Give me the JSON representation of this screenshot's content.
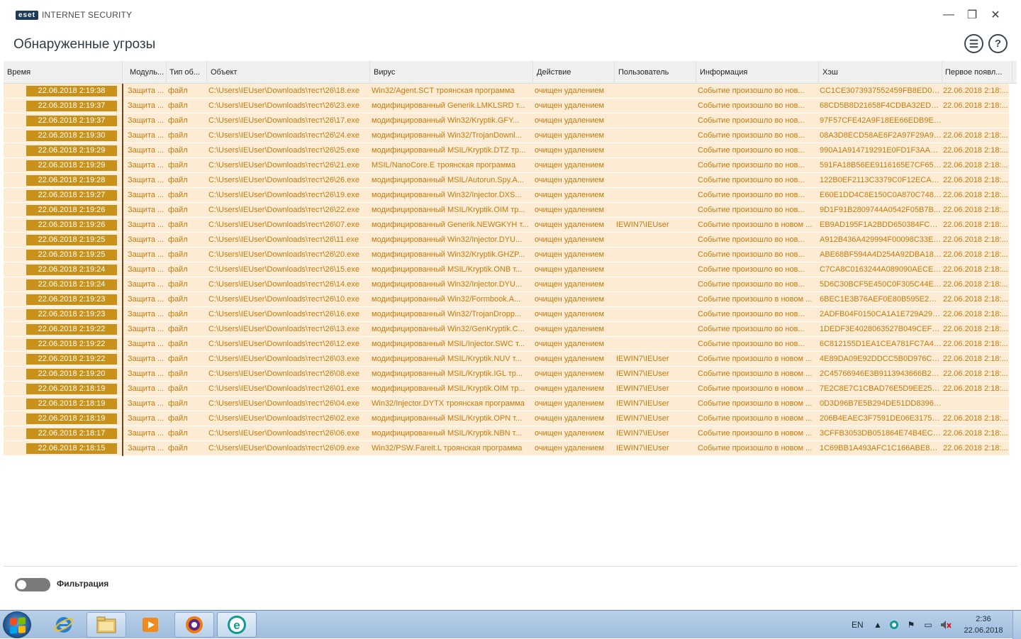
{
  "app": {
    "badge": "eset",
    "name": "INTERNET SECURITY"
  },
  "window_controls": {
    "minimize": "—",
    "maximize": "❐",
    "close": "✕"
  },
  "page": {
    "title": "Обнаруженные угрозы"
  },
  "header_icons": {
    "list": "☰",
    "help": "?"
  },
  "columns": {
    "time": "Время",
    "module": "Модуль...",
    "type": "Тип об...",
    "object": "Объект",
    "virus": "Вирус",
    "action": "Действие",
    "user": "Пользователь",
    "info": "Информация",
    "hash": "Хэш",
    "first": "Первое появл..."
  },
  "rows": [
    {
      "time": "22.06.2018 2:19:38",
      "module": "Защита ...",
      "type": "файл",
      "object": "C:\\Users\\IEUser\\Downloads\\тест\\26\\18.exe",
      "virus": "Win32/Agent.SCT троянская программа",
      "action": "очищен удалением",
      "user": "",
      "info": "Событие произошло во нов...",
      "hash": "CC1CE3073937552459FB8ED0A...",
      "first": "22.06.2018 2:18:..."
    },
    {
      "time": "22.06.2018 2:19:37",
      "module": "Защита ...",
      "type": "файл",
      "object": "C:\\Users\\IEUser\\Downloads\\тест\\26\\23.exe",
      "virus": "модифицированный Generik.LMKLSRD т...",
      "action": "очищен удалением",
      "user": "",
      "info": "Событие произошло во нов...",
      "hash": "68CD5B8D21658F4CDBA32EDC...",
      "first": "22.06.2018 2:18:..."
    },
    {
      "time": "22.06.2018 2:19:37",
      "module": "Защита ...",
      "type": "файл",
      "object": "C:\\Users\\IEUser\\Downloads\\тест\\26\\17.exe",
      "virus": "модифицированный Win32/Kryptik.GFY...",
      "action": "очищен удалением",
      "user": "",
      "info": "Событие произошло во нов...",
      "hash": "97F57CFE42A9F18EE66EDB9EE5...",
      "first": ""
    },
    {
      "time": "22.06.2018 2:19:30",
      "module": "Защита ...",
      "type": "файл",
      "object": "C:\\Users\\IEUser\\Downloads\\тест\\26\\24.exe",
      "virus": "модифицированный Win32/TrojanDownl...",
      "action": "очищен удалением",
      "user": "",
      "info": "Событие произошло во нов...",
      "hash": "08A3D8ECD58AE6F2A97F29A92...",
      "first": "22.06.2018 2:18:..."
    },
    {
      "time": "22.06.2018 2:19:29",
      "module": "Защита ...",
      "type": "файл",
      "object": "C:\\Users\\IEUser\\Downloads\\тест\\26\\25.exe",
      "virus": "модифицированный MSIL/Kryptik.DTZ тр...",
      "action": "очищен удалением",
      "user": "",
      "info": "Событие произошло во нов...",
      "hash": "990A1A914719291E0FD1F3AAE...",
      "first": "22.06.2018 2:18:..."
    },
    {
      "time": "22.06.2018 2:19:29",
      "module": "Защита ...",
      "type": "файл",
      "object": "C:\\Users\\IEUser\\Downloads\\тест\\26\\21.exe",
      "virus": "MSIL/NanoCore.E троянская программа",
      "action": "очищен удалением",
      "user": "",
      "info": "Событие произошло во нов...",
      "hash": "591FA18B56EE9116165E7CF653...",
      "first": "22.06.2018 2:18:..."
    },
    {
      "time": "22.06.2018 2:19:28",
      "module": "Защита ...",
      "type": "файл",
      "object": "C:\\Users\\IEUser\\Downloads\\тест\\26\\26.exe",
      "virus": "модифицированный MSIL/Autorun.Spy.A...",
      "action": "очищен удалением",
      "user": "",
      "info": "Событие произошло во нов...",
      "hash": "122B0EF2113C3379C0F12ECA0E...",
      "first": "22.06.2018 2:18:..."
    },
    {
      "time": "22.06.2018 2:19:27",
      "module": "Защита ...",
      "type": "файл",
      "object": "C:\\Users\\IEUser\\Downloads\\тест\\26\\19.exe",
      "virus": "модифицированный Win32/Injector.DXS...",
      "action": "очищен удалением",
      "user": "",
      "info": "Событие произошло во нов...",
      "hash": "E60E1DD4C8E150C0A870C7482...",
      "first": "22.06.2018 2:18:..."
    },
    {
      "time": "22.06.2018 2:19:26",
      "module": "Защита ...",
      "type": "файл",
      "object": "C:\\Users\\IEUser\\Downloads\\тест\\26\\22.exe",
      "virus": "модифицированный MSIL/Kryptik.OIM тр...",
      "action": "очищен удалением",
      "user": "",
      "info": "Событие произошло во нов...",
      "hash": "9D1F91B2809744A0542F05B7B...",
      "first": "22.06.2018 2:18:..."
    },
    {
      "time": "22.06.2018 2:19:26",
      "module": "Защита ...",
      "type": "файл",
      "object": "C:\\Users\\IEUser\\Downloads\\тест\\26\\07.exe",
      "virus": "модифицированный Generik.NEWGKYH т...",
      "action": "очищен удалением",
      "user": "IEWIN7\\IEUser",
      "info": "Событие произошло в новом ...",
      "hash": "EB9AD195F1A2BDD650384FC77...",
      "first": "22.06.2018 2:18:..."
    },
    {
      "time": "22.06.2018 2:19:25",
      "module": "Защита ...",
      "type": "файл",
      "object": "C:\\Users\\IEUser\\Downloads\\тест\\26\\11.exe",
      "virus": "модифицированный Win32/Injector.DYU...",
      "action": "очищен удалением",
      "user": "",
      "info": "Событие произошло во нов...",
      "hash": "A912B436A429994F00098C33E0...",
      "first": "22.06.2018 2:18:..."
    },
    {
      "time": "22.06.2018 2:19:25",
      "module": "Защита ...",
      "type": "файл",
      "object": "C:\\Users\\IEUser\\Downloads\\тест\\26\\20.exe",
      "virus": "модифицированный Win32/Kryptik.GHZP...",
      "action": "очищен удалением",
      "user": "",
      "info": "Событие произошло во нов...",
      "hash": "ABE68BF594A4D254A92DBA186...",
      "first": "22.06.2018 2:18:..."
    },
    {
      "time": "22.06.2018 2:19:24",
      "module": "Защита ...",
      "type": "файл",
      "object": "C:\\Users\\IEUser\\Downloads\\тест\\26\\15.exe",
      "virus": "модифицированный MSIL/Kryptik.ONB т...",
      "action": "очищен удалением",
      "user": "",
      "info": "Событие произошло во нов...",
      "hash": "C7CA8C0163244A089090AECE3...",
      "first": "22.06.2018 2:18:..."
    },
    {
      "time": "22.06.2018 2:19:24",
      "module": "Защита ...",
      "type": "файл",
      "object": "C:\\Users\\IEUser\\Downloads\\тест\\26\\14.exe",
      "virus": "модифицированный Win32/Injector.DYU...",
      "action": "очищен удалением",
      "user": "",
      "info": "Событие произошло во нов...",
      "hash": "5D6C30BCF5E450C0F305C44E1...",
      "first": "22.06.2018 2:18:..."
    },
    {
      "time": "22.06.2018 2:19:23",
      "module": "Защита ...",
      "type": "файл",
      "object": "C:\\Users\\IEUser\\Downloads\\тест\\26\\10.exe",
      "virus": "модифицированный Win32/Formbook.A...",
      "action": "очищен удалением",
      "user": "",
      "info": "Событие произошло в новом ...",
      "hash": "6BEC1E3B76AEF0E80B595E2D0...",
      "first": "22.06.2018 2:18:..."
    },
    {
      "time": "22.06.2018 2:19:23",
      "module": "Защита ...",
      "type": "файл",
      "object": "C:\\Users\\IEUser\\Downloads\\тест\\26\\16.exe",
      "virus": "модифицированный Win32/TrojanDropp...",
      "action": "очищен удалением",
      "user": "",
      "info": "Событие произошло во нов...",
      "hash": "2ADFB04F0150CA1A1E729A290...",
      "first": "22.06.2018 2:18:..."
    },
    {
      "time": "22.06.2018 2:19:22",
      "module": "Защита ...",
      "type": "файл",
      "object": "C:\\Users\\IEUser\\Downloads\\тест\\26\\13.exe",
      "virus": "модифицированный Win32/GenKryptik.C...",
      "action": "очищен удалением",
      "user": "",
      "info": "Событие произошло во нов...",
      "hash": "1DEDF3E4028063527B049CEF34...",
      "first": "22.06.2018 2:18:..."
    },
    {
      "time": "22.06.2018 2:19:22",
      "module": "Защита ...",
      "type": "файл",
      "object": "C:\\Users\\IEUser\\Downloads\\тест\\26\\12.exe",
      "virus": "модифицированный MSIL/Injector.SWC т...",
      "action": "очищен удалением",
      "user": "",
      "info": "Событие произошло во нов...",
      "hash": "6C812155D1EA1CEA781FC7A44...",
      "first": "22.06.2018 2:18:..."
    },
    {
      "time": "22.06.2018 2:19:22",
      "module": "Защита ...",
      "type": "файл",
      "object": "C:\\Users\\IEUser\\Downloads\\тест\\26\\03.exe",
      "virus": "модифицированный MSIL/Kryptik.NUV т...",
      "action": "очищен удалением",
      "user": "IEWIN7\\IEUser",
      "info": "Событие произошло в новом ...",
      "hash": "4E89DA09E92DDCC5B0D976C6...",
      "first": "22.06.2018 2:18:..."
    },
    {
      "time": "22.06.2018 2:19:20",
      "module": "Защита ...",
      "type": "файл",
      "object": "C:\\Users\\IEUser\\Downloads\\тест\\26\\08.exe",
      "virus": "модифицированный MSIL/Kryptik.IGL тр...",
      "action": "очищен удалением",
      "user": "IEWIN7\\IEUser",
      "info": "Событие произошло в новом ...",
      "hash": "2C45766946E3B9113943666B26...",
      "first": "22.06.2018 2:18:..."
    },
    {
      "time": "22.06.2018 2:18:19",
      "module": "Защита ...",
      "type": "файл",
      "object": "C:\\Users\\IEUser\\Downloads\\тест\\26\\01.exe",
      "virus": "модифицированный MSIL/Kryptik.OIM тр...",
      "action": "очищен удалением",
      "user": "IEWIN7\\IEUser",
      "info": "Событие произошло в новом ...",
      "hash": "7E2C8E7C1CBAD76E5D9EE25D2...",
      "first": "22.06.2018 2:18:..."
    },
    {
      "time": "22.06.2018 2:18:19",
      "module": "Защита ...",
      "type": "файл",
      "object": "C:\\Users\\IEUser\\Downloads\\тест\\26\\04.exe",
      "virus": "Win32/Injector.DYTX троянская программа",
      "action": "очищен удалением",
      "user": "IEWIN7\\IEUser",
      "info": "Событие произошло в новом ...",
      "hash": "0D3D96B7E5B294DE51DD83965...",
      "first": ""
    },
    {
      "time": "22.06.2018 2:18:19",
      "module": "Защита ...",
      "type": "файл",
      "object": "C:\\Users\\IEUser\\Downloads\\тест\\26\\02.exe",
      "virus": "модифицированный MSIL/Kryptik.OPN т...",
      "action": "очищен удалением",
      "user": "IEWIN7\\IEUser",
      "info": "Событие произошло в новом ...",
      "hash": "206B4EAEC3F7591DE06E3175D...",
      "first": "22.06.2018 2:18:..."
    },
    {
      "time": "22.06.2018 2:18:17",
      "module": "Защита ...",
      "type": "файл",
      "object": "C:\\Users\\IEUser\\Downloads\\тест\\26\\06.exe",
      "virus": "модифицированный MSIL/Kryptik.NBN т...",
      "action": "очищен удалением",
      "user": "IEWIN7\\IEUser",
      "info": "Событие произошло в новом ...",
      "hash": "3CFFB3053DB051864E74B4ECF...",
      "first": "22.06.2018 2:18:..."
    },
    {
      "time": "22.06.2018 2:18:15",
      "module": "Защита ...",
      "type": "файл",
      "object": "C:\\Users\\IEUser\\Downloads\\тест\\26\\09.exe",
      "virus": "Win32/PSW.Fareit.L троянская программа",
      "action": "очищен удалением",
      "user": "IEWIN7\\IEUser",
      "info": "Событие произошло в новом ...",
      "hash": "1C69BB1A493AFC1C166ABE883...",
      "first": "22.06.2018 2:18:..."
    }
  ],
  "filter": {
    "label": "Фильтрация",
    "enabled": false
  },
  "taskbar": {
    "language": "EN",
    "time": "2:36",
    "date": "22.06.2018",
    "apps": [
      "internet-explorer",
      "file-explorer",
      "media-player",
      "avast-browser",
      "eset"
    ]
  },
  "colors": {
    "row_bg": "#fdecd3",
    "row_text": "#c47a0d",
    "time_badge": "#c8921a",
    "header_bg": "#f0f0f0"
  }
}
